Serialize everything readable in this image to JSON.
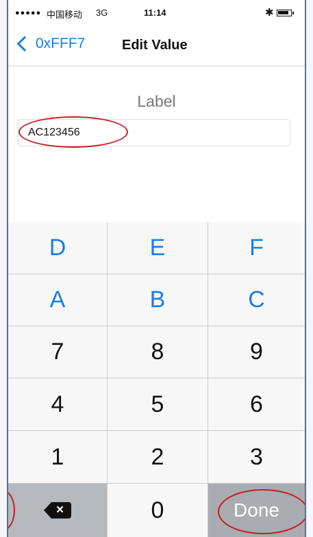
{
  "status_bar": {
    "signal": "●●●●●",
    "carrier": "中国移动",
    "network": "3G",
    "time": "11:14",
    "bluetooth_icon": "bluetooth-icon",
    "battery_icon": "battery-icon"
  },
  "nav": {
    "back_label": "0xFFF7",
    "title": "Edit Value"
  },
  "form": {
    "label": "Label",
    "value": "AC123456"
  },
  "keypad": {
    "rows": [
      [
        "D",
        "E",
        "F"
      ],
      [
        "A",
        "B",
        "C"
      ],
      [
        "7",
        "8",
        "9"
      ],
      [
        "4",
        "5",
        "6"
      ],
      [
        "1",
        "2",
        "3"
      ]
    ],
    "zero": "0",
    "done_label": "Done",
    "delete_icon": "backspace-icon"
  },
  "colors": {
    "accent": "#1a7ee6",
    "annotation": "#c41e23"
  }
}
